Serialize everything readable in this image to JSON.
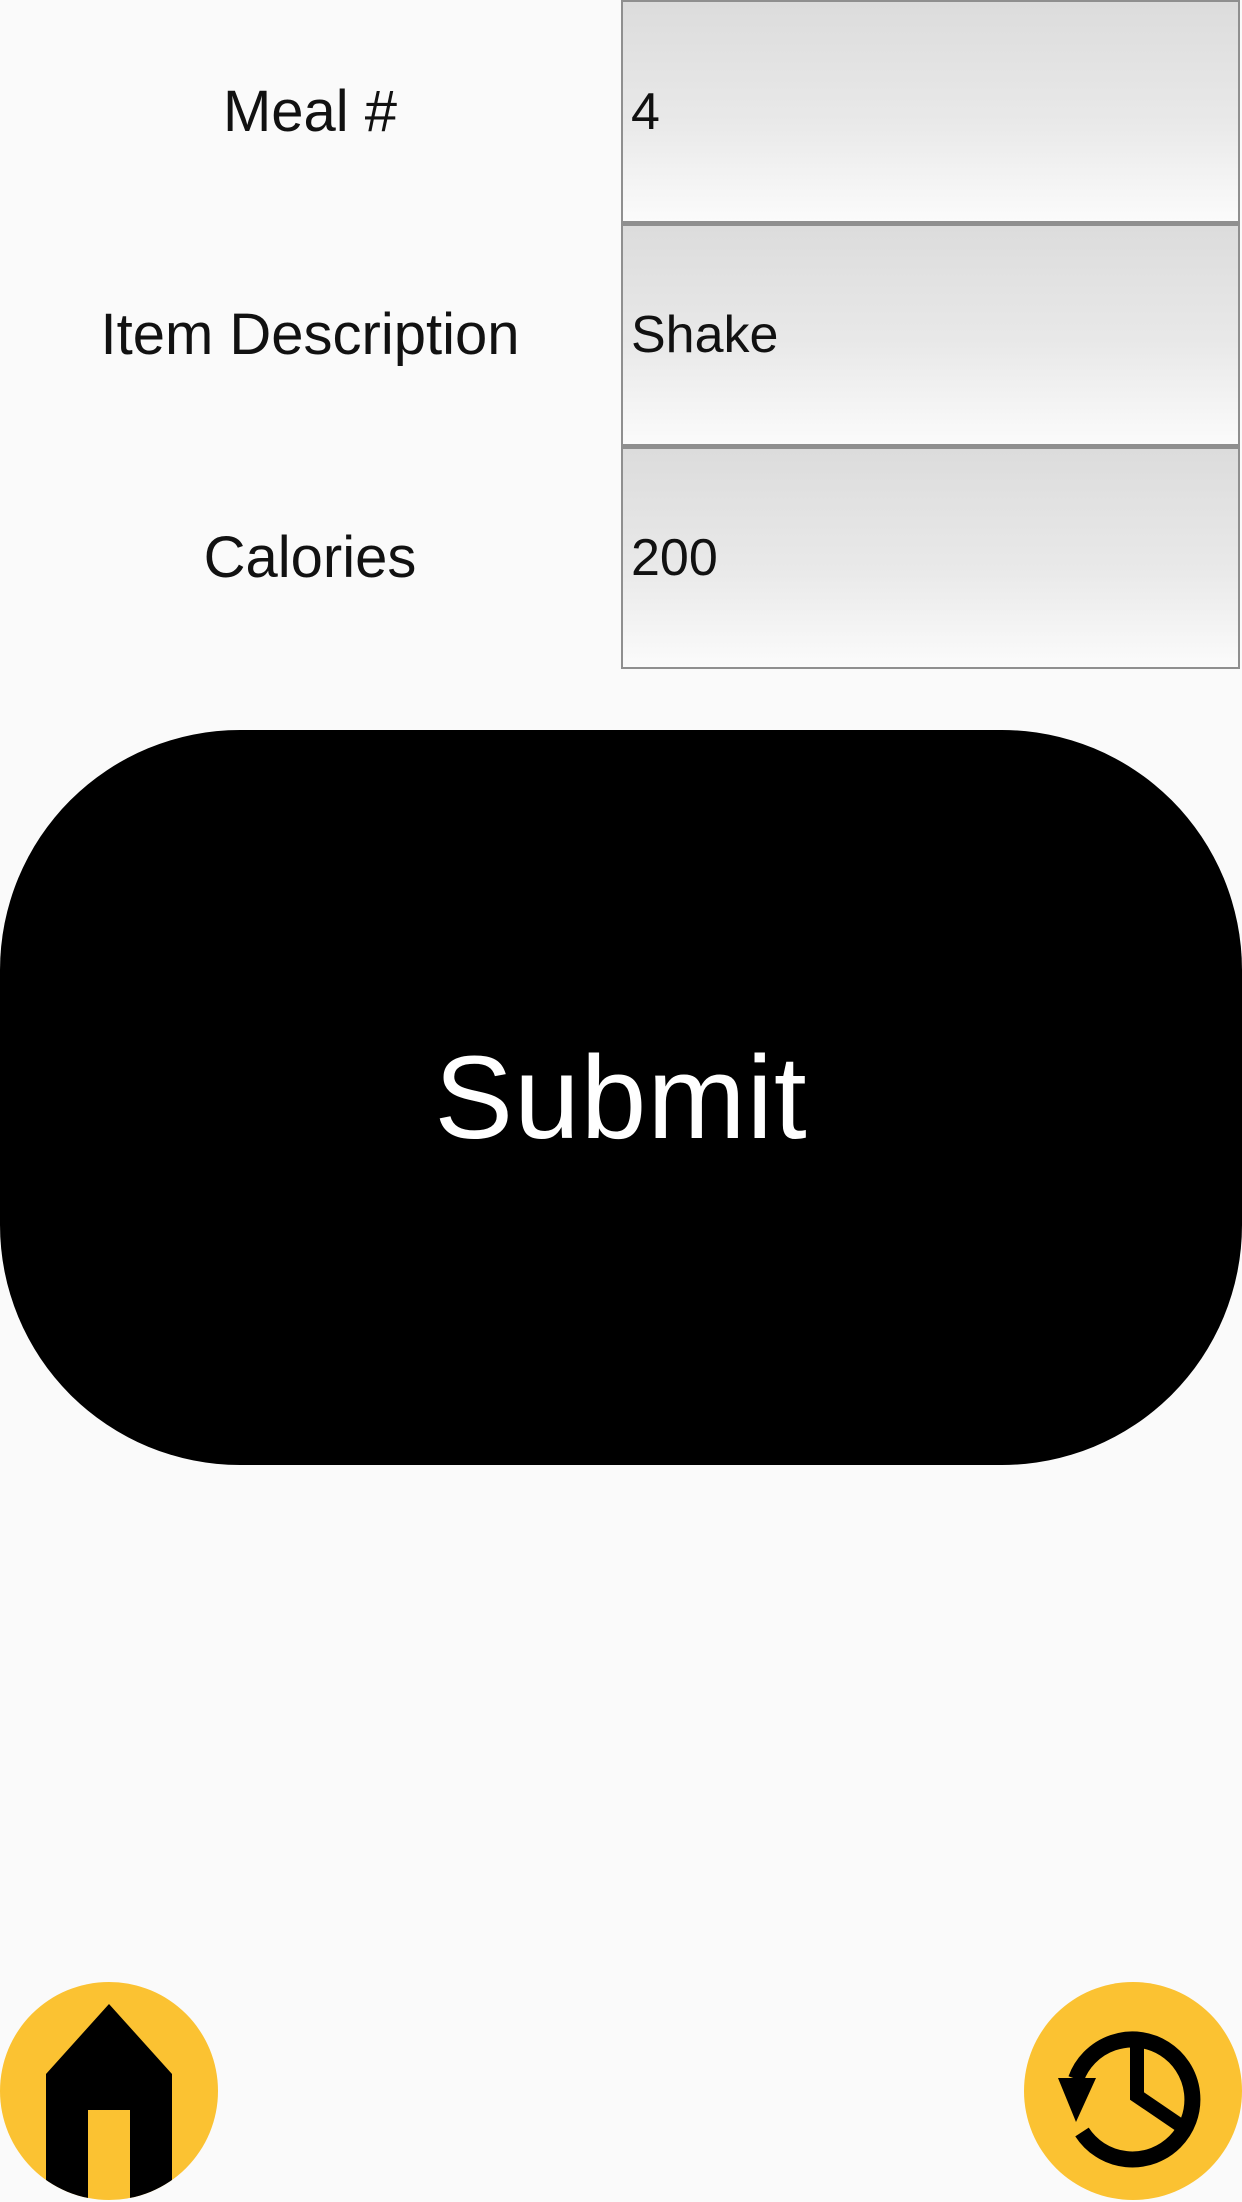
{
  "form": {
    "fields": [
      {
        "label": "Meal #",
        "value": "4"
      },
      {
        "label": "Item Description",
        "value": "Shake"
      },
      {
        "label": "Calories",
        "value": "200"
      }
    ]
  },
  "submit": {
    "label": "Submit"
  },
  "bottom_nav": {
    "home_icon": "home-icon",
    "history_icon": "history-icon",
    "accent_color": "#fbc232"
  },
  "colors": {
    "background": "#fafafa",
    "button": "#000000",
    "button_text": "#ffffff"
  }
}
